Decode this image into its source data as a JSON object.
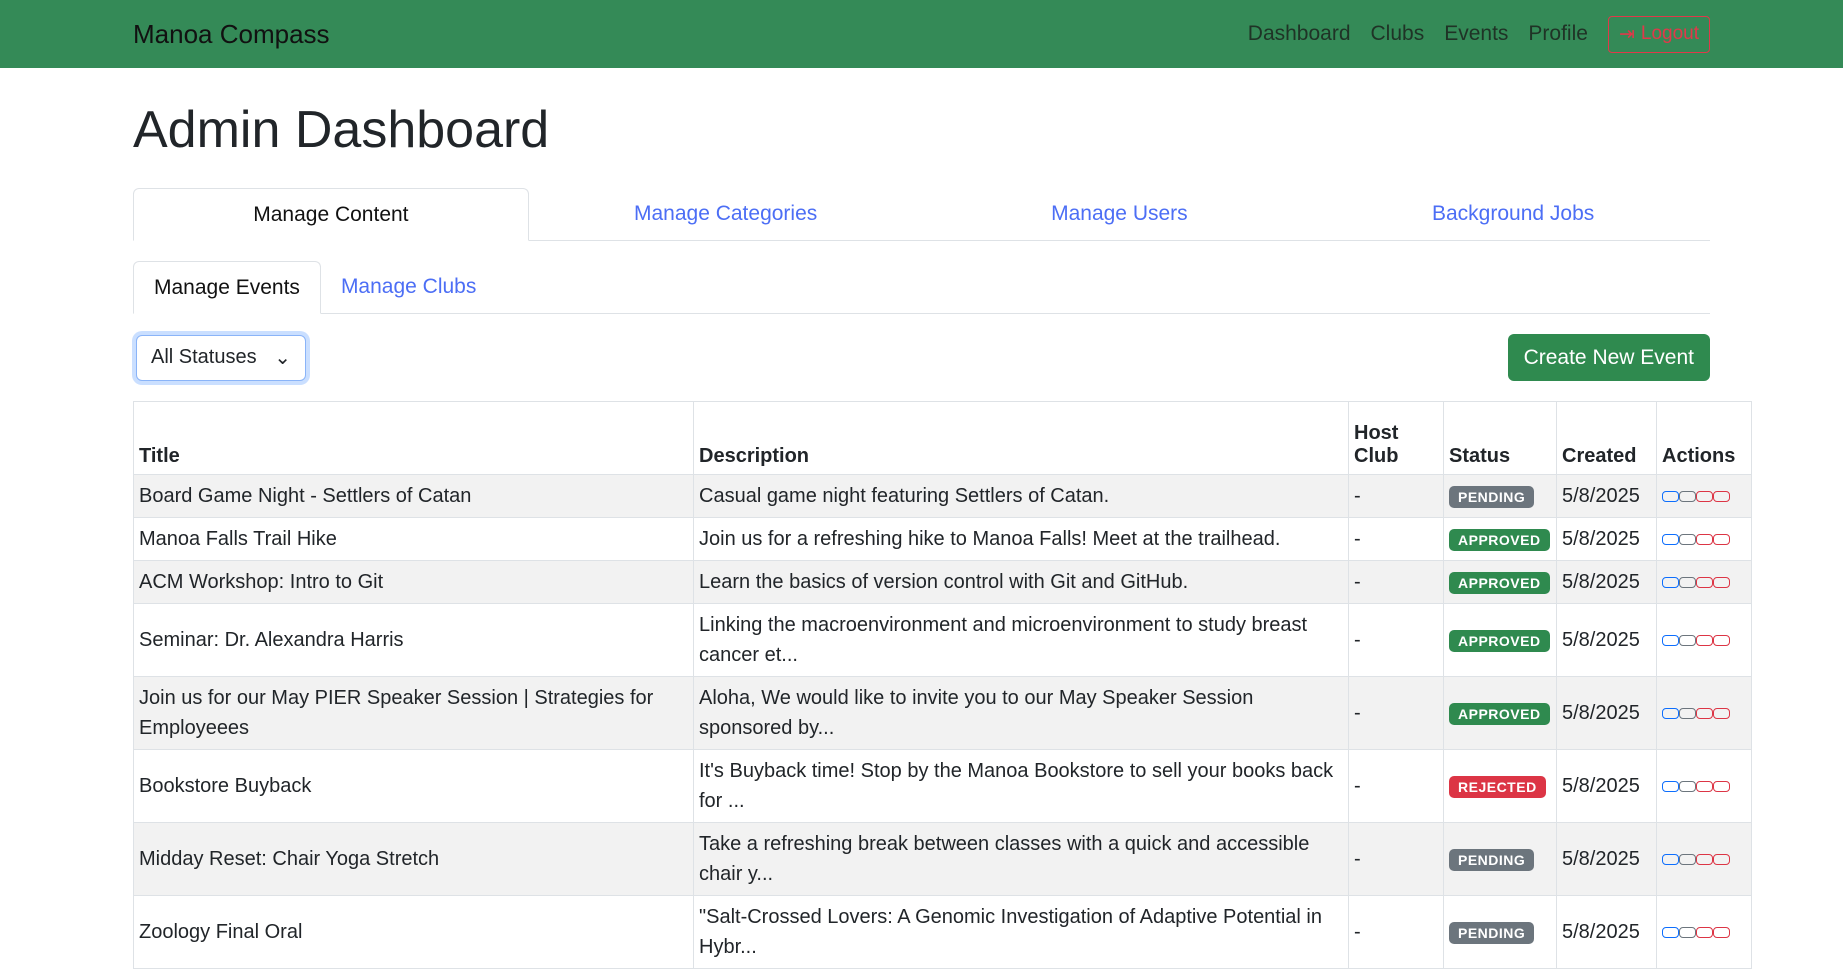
{
  "nav": {
    "brand": "Manoa Compass",
    "links": [
      "Dashboard",
      "Clubs",
      "Events",
      "Profile"
    ],
    "logout": "Logout"
  },
  "page": {
    "title": "Admin Dashboard"
  },
  "tabs": [
    "Manage Content",
    "Manage Categories",
    "Manage Users",
    "Background Jobs"
  ],
  "subtabs": [
    "Manage Events",
    "Manage Clubs"
  ],
  "filter": {
    "selected": "All Statuses"
  },
  "create_button": "Create New Event",
  "table": {
    "headers": [
      "Title",
      "Description",
      "Host Club",
      "Status",
      "Created",
      "Actions"
    ],
    "rows": [
      {
        "title": "Board Game Night - Settlers of Catan",
        "description": "Casual game night featuring Settlers of Catan.",
        "host": "-",
        "status": "PENDING",
        "created": "5/8/2025"
      },
      {
        "title": "Manoa Falls Trail Hike",
        "description": "Join us for a refreshing hike to Manoa Falls! Meet at the trailhead.",
        "host": "-",
        "status": "APPROVED",
        "created": "5/8/2025"
      },
      {
        "title": "ACM Workshop: Intro to Git",
        "description": "Learn the basics of version control with Git and GitHub.",
        "host": "-",
        "status": "APPROVED",
        "created": "5/8/2025"
      },
      {
        "title": "Seminar: Dr. Alexandra Harris",
        "description": "Linking the macroenvironment and microenvironment to study breast cancer et...",
        "host": "-",
        "status": "APPROVED",
        "created": "5/8/2025"
      },
      {
        "title": "Join us for our May PIER Speaker Session | Strategies for Employeees",
        "description": "Aloha, We would like to invite you to our May Speaker Session sponsored by...",
        "host": "-",
        "status": "APPROVED",
        "created": "5/8/2025"
      },
      {
        "title": "Bookstore Buyback",
        "description": "It's Buyback time! Stop by the Manoa Bookstore to sell your books back for ...",
        "host": "-",
        "status": "REJECTED",
        "created": "5/8/2025"
      },
      {
        "title": "Midday Reset: Chair Yoga Stretch",
        "description": "Take a refreshing break between classes with a quick and accessible chair y...",
        "host": "-",
        "status": "PENDING",
        "created": "5/8/2025"
      },
      {
        "title": "Zoology Final Oral",
        "description": "\"Salt-Crossed Lovers: A Genomic Investigation of Adaptive Potential in Hybr...",
        "host": "-",
        "status": "PENDING",
        "created": "5/8/2025"
      }
    ]
  },
  "colors": {
    "navbar": "#348a57",
    "pending": "#6c757d",
    "approved": "#2f8a4f",
    "rejected": "#dc3545",
    "action_colors": [
      "#0d6efd",
      "#6c757d",
      "#dc3545",
      "#dc3545"
    ]
  }
}
